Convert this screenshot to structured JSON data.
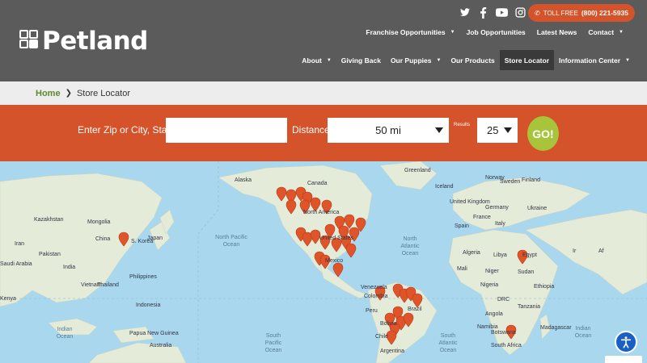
{
  "brand": {
    "name": "Petland"
  },
  "header": {
    "toll_label": "TOLL FREE",
    "toll_number": "(800) 221-5935",
    "nav_top": [
      {
        "label": "Franchise Opportunities",
        "has_dropdown": true
      },
      {
        "label": "Job Opportunities",
        "has_dropdown": false
      },
      {
        "label": "Latest News",
        "has_dropdown": false
      },
      {
        "label": "Contact",
        "has_dropdown": true
      }
    ],
    "nav_main": [
      {
        "label": "About",
        "has_dropdown": true
      },
      {
        "label": "Giving Back",
        "has_dropdown": false
      },
      {
        "label": "Our Puppies",
        "has_dropdown": true
      },
      {
        "label": "Our Products",
        "has_dropdown": false
      },
      {
        "label": "Store Locator",
        "has_dropdown": false,
        "active": true
      },
      {
        "label": "Information Center",
        "has_dropdown": true
      }
    ],
    "social_icons": [
      "twitter-icon",
      "facebook-icon",
      "youtube-icon",
      "instagram-icon"
    ]
  },
  "breadcrumb": {
    "home": "Home",
    "current": "Store Locator"
  },
  "search": {
    "zip_label": "Enter Zip or City, State",
    "zip_value": "",
    "distance_label": "Distance",
    "distance_value": "50 mi",
    "results_label": "Results",
    "results_value": "25",
    "go_label": "GO!"
  },
  "map": {
    "labels": [
      "Kazakhstan",
      "Mongolia",
      "China",
      "Japan",
      "S. Korea",
      "Pakistan",
      "Iran",
      "India",
      "Saudi Arabia",
      "Thailand",
      "Kenya",
      "Indonesia",
      "Australia",
      "Alaska",
      "Canada",
      "North America",
      "United States",
      "Mexico",
      "Venezuela",
      "Colombia",
      "Brazil",
      "Peru",
      "Bolivia",
      "Chile",
      "Argentina",
      "Greenland",
      "Iceland",
      "United Kingdom",
      "Norway",
      "Sweden",
      "Finland",
      "Ukraine",
      "Germany",
      "France",
      "Spain",
      "Italy",
      "Algeria",
      "Libya",
      "Egypt",
      "Mali",
      "Niger",
      "Sudan",
      "Nigeria",
      "Ethiopia",
      "DRC",
      "Tanzania",
      "Angola",
      "Namibia",
      "Botswana",
      "South Africa",
      "Madagascar",
      "Papua New Guinea",
      "Philippines",
      "Vietnam",
      "Ir",
      "Af"
    ],
    "oceans": [
      "North Pacific Ocean",
      "North Atlantic Ocean",
      "South Pacific Ocean",
      "South Atlantic Ocean",
      "Indian Ocean",
      "Indian Ocean"
    ],
    "marker_color": "#e0542a"
  },
  "colors": {
    "header_bg": "#5b5b5b",
    "accent": "#d4532a",
    "go_green": "#a8c43a",
    "home_green": "#5e8a2a"
  }
}
